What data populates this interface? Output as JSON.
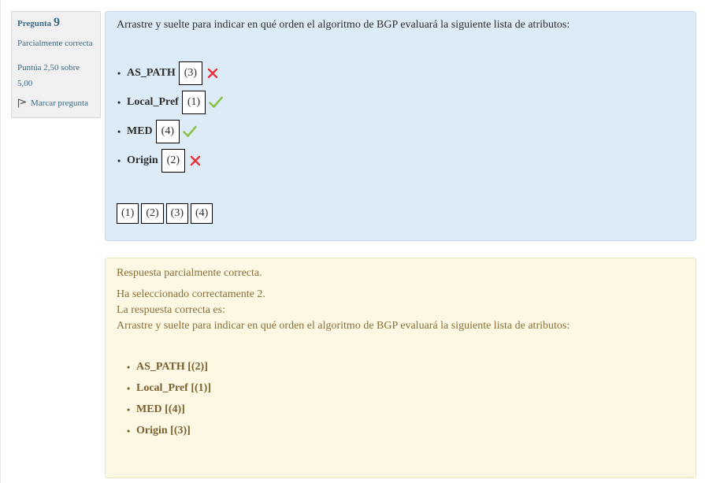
{
  "info": {
    "question_word": "Pregunta",
    "question_number": "9",
    "state": "Parcialmente correcta",
    "grade_line1": "Puntúa 2,50 sobre",
    "grade_line2": "5,00",
    "flag_label": "Marcar pregunta"
  },
  "formulation": {
    "question_text": "Arrastre y suelte para indicar en qué orden el algoritmo de BGP evaluará la siguiente lista de atributos:",
    "items": [
      {
        "label": "AS_PATH",
        "dropped": "(3)",
        "mark": "cross-icon"
      },
      {
        "label": "Local_Pref",
        "dropped": "(1)",
        "mark": "check-icon"
      },
      {
        "label": "MED",
        "dropped": "(4)",
        "mark": "check-icon"
      },
      {
        "label": "Origin",
        "dropped": "(2)",
        "mark": "cross-icon"
      }
    ],
    "choices": [
      "(1)",
      "(2)",
      "(3)",
      "(4)"
    ]
  },
  "feedback": {
    "summary": "Respuesta parcialmente correcta.",
    "selected": "Ha seleccionado correctamente 2.",
    "correct_intro": "La respuesta correcta es:",
    "question_text": "Arrastre y suelte para indicar en qué orden el algoritmo de BGP evaluará la siguiente lista de atributos:",
    "answers": [
      "AS_PATH [(2)]",
      "Local_Pref [(1)]",
      "MED [(4)]",
      "Origin [(3)]"
    ]
  },
  "colors": {
    "info_text": "#3d6b86",
    "formulation_bg": "#dcebf5",
    "outcome_bg": "#fcf8e3",
    "check": "#8bc34a",
    "cross": "#e8323c"
  }
}
